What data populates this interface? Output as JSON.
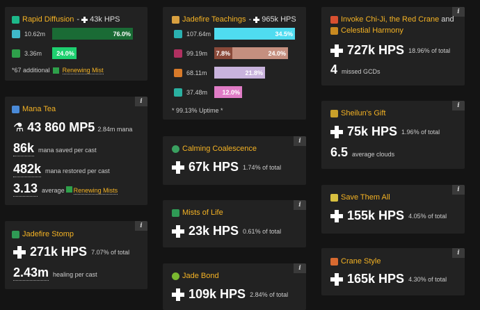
{
  "rapid_diffusion": {
    "title": "Rapid Diffusion",
    "sep": " - ",
    "hps": "43k HPS",
    "rows": [
      {
        "value": "10.62m",
        "pct": "76.0%",
        "fill": 0.76,
        "color": "#1a6b35"
      },
      {
        "value": "3.36m",
        "pct": "24.0%",
        "fill": 0.24,
        "color": "#1ed070"
      }
    ],
    "note_prefix": "*67 additional",
    "note_link": "Renewing Mist"
  },
  "jadefire_teachings": {
    "title": "Jadefire Teachings",
    "sep": " - ",
    "hps": "965k HPS",
    "rows": [
      {
        "value": "107.64m",
        "segments": [
          {
            "pct": "34.5%",
            "fill": 0.345,
            "color": "#4fdcf0"
          }
        ]
      },
      {
        "value": "99.19m",
        "segments": [
          {
            "pct": "7.8%",
            "fill": 0.078,
            "color": "#8a4a3a"
          },
          {
            "pct": "24.0%",
            "fill": 0.24,
            "color": "#c58f7f"
          }
        ]
      },
      {
        "value": "68.11m",
        "segments": [
          {
            "pct": "21.8%",
            "fill": 0.218,
            "color": "#c9b3dd"
          }
        ]
      },
      {
        "value": "37.48m",
        "segments": [
          {
            "pct": "12.0%",
            "fill": 0.12,
            "color": "#e07cc6"
          }
        ]
      }
    ],
    "uptime": "* 99.13% Uptime *"
  },
  "invoke_chiji": {
    "title_a": "Invoke Chi-Ji, the Red Crane",
    "title_and": " and",
    "title_b": "Celestial Harmony",
    "hps": "727k HPS",
    "pct": "18.96% of total",
    "missed": "4",
    "missed_label": "missed GCDs"
  },
  "mana_tea": {
    "title": "Mana Tea",
    "mp5": "43 860 MP5",
    "mana": "2.84m mana",
    "saved": "86k",
    "saved_label": "mana saved per cast",
    "restored": "482k",
    "restored_label": "mana restored per cast",
    "avg": "3.13",
    "avg_label": "average",
    "avg_link": "Renewing Mists"
  },
  "sheilun": {
    "title": "Sheilun's Gift",
    "hps": "75k HPS",
    "pct": "1.96% of total",
    "clouds": "6.5",
    "clouds_label": "average clouds"
  },
  "calming": {
    "title": "Calming Coalescence",
    "hps": "67k HPS",
    "pct": "1.74% of total"
  },
  "save_them_all": {
    "title": "Save Them All",
    "hps": "155k HPS",
    "pct": "4.05% of total"
  },
  "mists_of_life": {
    "title": "Mists of Life",
    "hps": "23k HPS",
    "pct": "0.61% of total"
  },
  "jadefire_stomp": {
    "title": "Jadefire Stomp",
    "hps": "271k HPS",
    "pct": "7.07% of total",
    "healing": "2.43m",
    "healing_label": "healing per cast"
  },
  "crane_style": {
    "title": "Crane Style",
    "hps": "165k HPS",
    "pct": "4.30% of total"
  },
  "jade_bond": {
    "title": "Jade Bond",
    "hps": "109k HPS",
    "pct": "2.84% of total"
  },
  "info_label": "i"
}
